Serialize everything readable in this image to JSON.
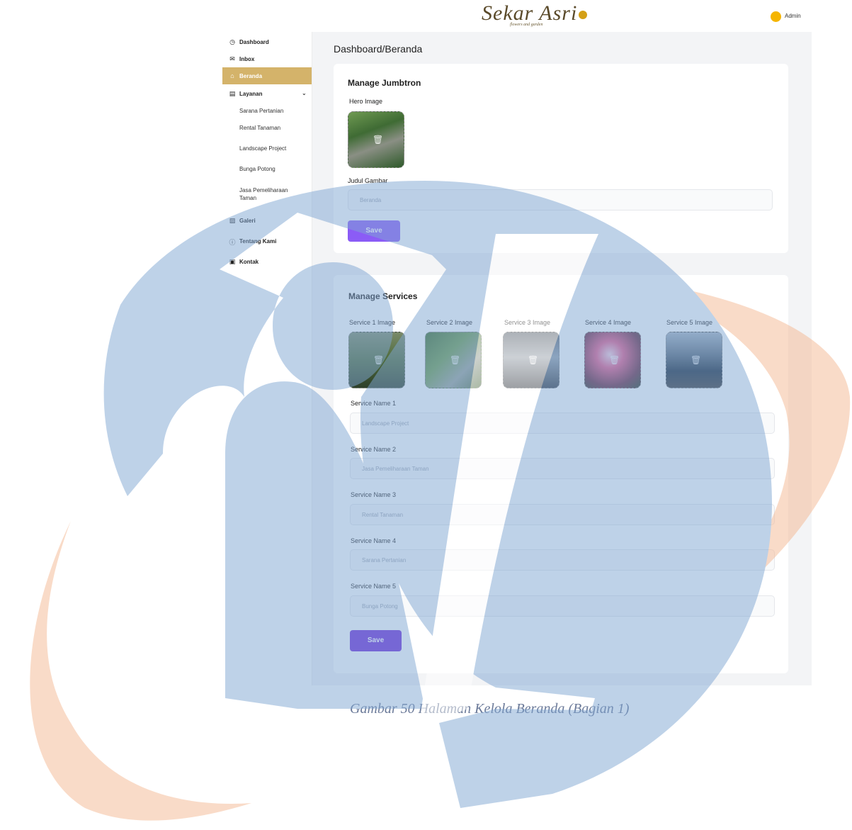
{
  "header": {
    "logo_text": "Sekar Asri",
    "logo_subtitle": "flowers and garden",
    "user_label": "Admin",
    "avatar_color": "#f5b500"
  },
  "sidebar": {
    "items": [
      {
        "label": "Dashboard",
        "icon": "dashboard-icon"
      },
      {
        "label": "Inbox",
        "icon": "mail-icon"
      },
      {
        "label": "Beranda",
        "icon": "home-icon",
        "active": true
      },
      {
        "label": "Layanan",
        "icon": "document-icon",
        "expanded": true
      },
      {
        "label": "Galeri",
        "icon": "image-icon"
      },
      {
        "label": "Tentang Kami",
        "icon": "info-icon"
      },
      {
        "label": "Kontak",
        "icon": "contact-icon"
      }
    ],
    "layanan_sub": [
      "Sarana Pertanian",
      "Rental Tanaman",
      "Landscape Project",
      "Bunga Potong",
      "Jasa Pemeliharaan Taman"
    ],
    "active_color": "#d4b36a"
  },
  "main": {
    "page_title": "Dashboard/Beranda",
    "jumbotron": {
      "title": "Manage Jumbtron",
      "hero_label": "Hero Image",
      "judul_label": "Judul Gambar",
      "judul_placeholder": "Beranda",
      "save_label": "Save",
      "button_color": "#8b5cf6"
    },
    "services": {
      "title": "Manage Services",
      "images": [
        "Service 1 Image",
        "Service 2 Image",
        "Service 3 Image",
        "Service 4 Image",
        "Service 5 Image"
      ],
      "fields": [
        {
          "label": "Service Name 1",
          "placeholder": "Landscape Project"
        },
        {
          "label": "Service Name 2",
          "placeholder": "Jasa Pemeliharaan Taman"
        },
        {
          "label": "Service Name 3",
          "placeholder": "Rental Tanaman"
        },
        {
          "label": "Service Name 4",
          "placeholder": "Sarana Pertanian"
        },
        {
          "label": "Service Name 5",
          "placeholder": "Bunga Potong"
        }
      ],
      "save_label": "Save",
      "button_color": "#6d28d9"
    }
  },
  "caption": "Gambar 50 Halaman Kelola Beranda (Bagian 1)"
}
